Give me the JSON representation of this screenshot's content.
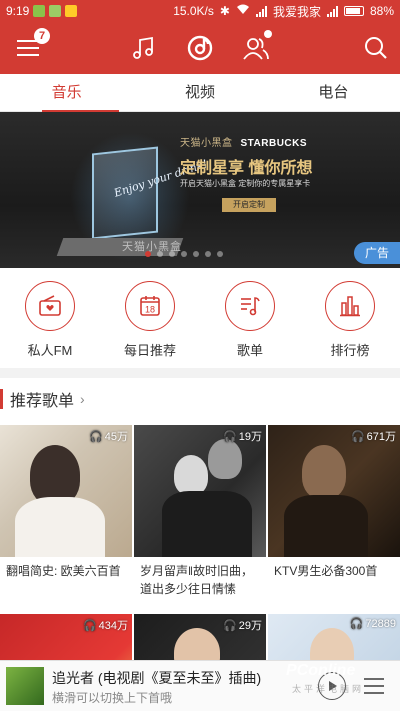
{
  "status_bar": {
    "time": "9:19",
    "speed": "15.0K/s",
    "carrier": "我爱我家",
    "battery": "88%"
  },
  "header": {
    "menu_badge": "7",
    "icons": [
      "menu-icon",
      "music-note-icon",
      "netease-music-icon",
      "friends-icon",
      "search-icon"
    ]
  },
  "tabs": [
    {
      "label": "音乐",
      "active": true
    },
    {
      "label": "视频",
      "active": false
    },
    {
      "label": "电台",
      "active": false
    }
  ],
  "banner": {
    "brand_left": "天猫小黑盒",
    "brand_right": "STARBUCKS",
    "headline": "定制星享 懂你所想",
    "subline": "开启天猫小黑盒 定制你的专属星享卡",
    "cta": "开启定制",
    "card_script": "Enjoy your drink!",
    "box_text": "天猫小黑盒",
    "ad_label": "广告",
    "page_count": 7,
    "active_page": 0
  },
  "quick_entries": [
    {
      "label": "私人FM",
      "icon": "radio-icon"
    },
    {
      "label": "每日推荐",
      "icon": "calendar-icon",
      "date": "18"
    },
    {
      "label": "歌单",
      "icon": "playlist-icon"
    },
    {
      "label": "排行榜",
      "icon": "chart-icon"
    }
  ],
  "section": {
    "title": "推荐歌单",
    "arrow": "›"
  },
  "playlists": [
    {
      "count": "45万",
      "title": "翻唱简史: 欧美六百首"
    },
    {
      "count": "19万",
      "title": "岁月留声‖故时旧曲，道出多少往日情愫"
    },
    {
      "count": "671万",
      "title": "KTV男生必备300首"
    },
    {
      "count": "434万",
      "title": ""
    },
    {
      "count": "29万",
      "title": ""
    },
    {
      "count": "72889",
      "title": ""
    }
  ],
  "player": {
    "song": "追光者 (电视剧《夏至未至》插曲)",
    "hint": "横滑可以切换上下首哦"
  },
  "watermark": {
    "text": "PConline",
    "sub": "太平洋电脑网"
  },
  "colors": {
    "accent": "#d23b33",
    "ad_badge": "#4a90d9"
  }
}
